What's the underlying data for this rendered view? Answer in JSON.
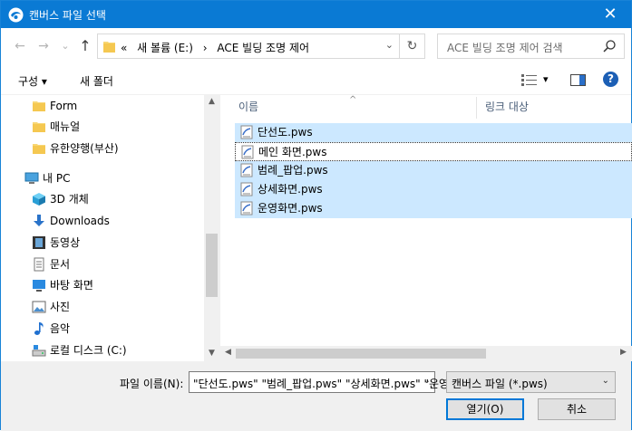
{
  "window": {
    "title": "캔버스 파일 선택",
    "close_glyph": "✕"
  },
  "nav": {
    "back_glyph": "←",
    "forward_glyph": "→",
    "recent_glyph": "⌄",
    "up_glyph": "↑",
    "breadcrumb": [
      "«",
      "새 볼륨 (E:)",
      "›",
      "ACE 빌딩 조명 제어"
    ],
    "addr_dropdown_glyph": "⌄",
    "refresh_glyph": "↻",
    "search_placeholder": "ACE 빌딩 조명 제어 검색"
  },
  "toolbar": {
    "organize_label": "구성 ▾",
    "new_folder_label": "새 폴더",
    "view_dropdown_glyph": "▾",
    "help_glyph": "?"
  },
  "sidebar": {
    "items": [
      {
        "label": "Form",
        "icon": "folder-icon"
      },
      {
        "label": "매뉴얼",
        "icon": "folder-icon"
      },
      {
        "label": "유한양행(부산)",
        "icon": "folder-icon"
      },
      {
        "label": "내 PC",
        "icon": "pc-icon"
      },
      {
        "label": "3D 개체",
        "icon": "cube-icon"
      },
      {
        "label": "Downloads",
        "icon": "download-icon"
      },
      {
        "label": "동영상",
        "icon": "video-icon"
      },
      {
        "label": "문서",
        "icon": "document-icon"
      },
      {
        "label": "바탕 화면",
        "icon": "desktop-icon"
      },
      {
        "label": "사진",
        "icon": "picture-icon"
      },
      {
        "label": "음악",
        "icon": "music-icon"
      },
      {
        "label": "로컬 디스크 (C:)",
        "icon": "drive-icon"
      }
    ]
  },
  "columns": {
    "name": "이름",
    "link_target": "링크 대상",
    "sort_glyph": "^"
  },
  "files": [
    {
      "name": "단선도.pws",
      "selected": true
    },
    {
      "name": "메인 화면.pws",
      "selected": false,
      "focused": true
    },
    {
      "name": "범례_팝업.pws",
      "selected": true
    },
    {
      "name": "상세화면.pws",
      "selected": true
    },
    {
      "name": "운영화면.pws",
      "selected": true
    }
  ],
  "bottom": {
    "filename_label": "파일 이름(N):",
    "filename_value": "\"단선도.pws\" \"범례_팝업.pws\" \"상세화면.pws\" \"운영",
    "filetype_value": "캔버스 파일 (*.pws)",
    "dropdown_glyph": "⌄",
    "open_label": "열기(O)",
    "cancel_label": "취소"
  },
  "colors": {
    "titlebar": "#0a7ad4",
    "selection": "#cce8ff",
    "folder": "#f8d775",
    "accent": "#0078d7"
  }
}
